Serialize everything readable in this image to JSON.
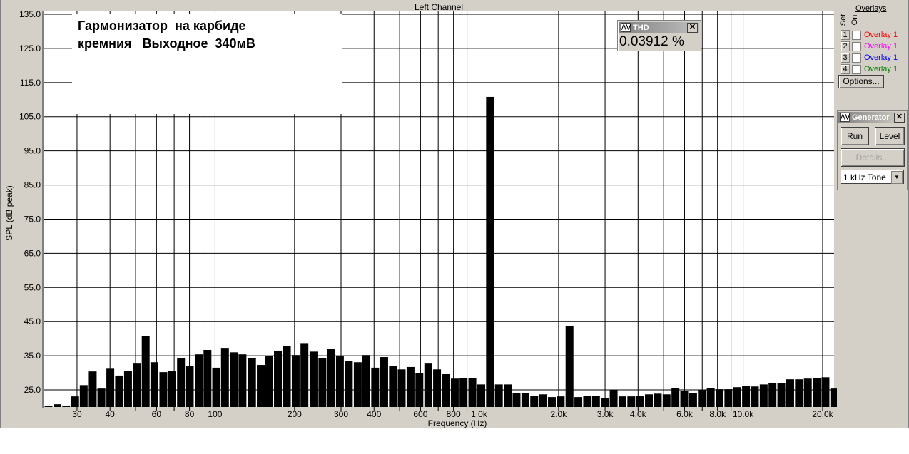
{
  "window": {
    "title": "Left Channel"
  },
  "annotation": {
    "line1": "Гармонизатор  на карбиде",
    "line2": "кремния   Выходное  340мВ"
  },
  "thd": {
    "title": "THD",
    "value": "0.03912 %",
    "icon": "waveform-icon"
  },
  "overlays": {
    "header": "Overlays",
    "set_label": "Set",
    "on_label": "On",
    "items": [
      {
        "set": "1",
        "label": "Overlay 1",
        "color": "#ff0000"
      },
      {
        "set": "2",
        "label": "Overlay 1",
        "color": "#ff00ff"
      },
      {
        "set": "3",
        "label": "Overlay 1",
        "color": "#0000ff"
      },
      {
        "set": "4",
        "label": "Overlay 1",
        "color": "#008000"
      }
    ],
    "options_label": "Options..."
  },
  "generator": {
    "title": "Generator",
    "run_label": "Run",
    "level_label": "Level",
    "details_label": "Details...",
    "tone_value": "1 kHz Tone"
  },
  "chart_data": {
    "type": "bar",
    "xlabel": "Frequency (Hz)",
    "ylabel": "SPL (dB peak)",
    "xscale": "log",
    "xlim": [
      22.4,
      22100
    ],
    "ylim": [
      20,
      135
    ],
    "grid": true,
    "xticks": [
      {
        "v": 30,
        "l": "30"
      },
      {
        "v": 40,
        "l": "40"
      },
      {
        "v": 60,
        "l": "60"
      },
      {
        "v": 80,
        "l": "80"
      },
      {
        "v": 100,
        "l": "100"
      },
      {
        "v": 200,
        "l": "200"
      },
      {
        "v": 300,
        "l": "300"
      },
      {
        "v": 400,
        "l": "400"
      },
      {
        "v": 600,
        "l": "600"
      },
      {
        "v": 800,
        "l": "800"
      },
      {
        "v": 1000,
        "l": "1.0k"
      },
      {
        "v": 2000,
        "l": "2.0k"
      },
      {
        "v": 3000,
        "l": "3.0k"
      },
      {
        "v": 4000,
        "l": "4.0k"
      },
      {
        "v": 6000,
        "l": "6.0k"
      },
      {
        "v": 8000,
        "l": "8.0k"
      },
      {
        "v": 10000,
        "l": "10.0k"
      },
      {
        "v": 20000,
        "l": "20.0k"
      }
    ],
    "xgrid": [
      30,
      40,
      50,
      60,
      70,
      80,
      90,
      100,
      200,
      300,
      400,
      500,
      600,
      700,
      800,
      900,
      1000,
      2000,
      3000,
      4000,
      5000,
      6000,
      7000,
      8000,
      9000,
      10000,
      20000
    ],
    "yticks": [
      "25.0",
      "35.0",
      "45.0",
      "55.0",
      "65.0",
      "75.0",
      "85.0",
      "95.0",
      "105.0",
      "115.0",
      "125.0",
      "135.0"
    ],
    "x": [
      23.4,
      25.3,
      27.3,
      29.5,
      31.8,
      34.4,
      37.1,
      40.1,
      43.3,
      46.8,
      50.5,
      54.6,
      58.9,
      63.7,
      68.8,
      74.3,
      80.2,
      86.7,
      93.6,
      101,
      109,
      118,
      127,
      138,
      149,
      160,
      173,
      187,
      202,
      218,
      236,
      255,
      275,
      297,
      321,
      347,
      374,
      404,
      437,
      472,
      509,
      550,
      594,
      642,
      693,
      749,
      809,
      873,
      943,
      1019,
      1100,
      1188,
      1283,
      1386,
      1497,
      1617,
      1746,
      1886,
      2037,
      2200,
      2376,
      2566,
      2771,
      2993,
      3233,
      3491,
      3771,
      4073,
      4398,
      4750,
      5130,
      5541,
      5984,
      6463,
      6980,
      7538,
      8141,
      8793,
      9496,
      10256,
      11076,
      11962,
      12919,
      13953,
      15069,
      16275,
      17577,
      18983,
      20502,
      22142
    ],
    "values": [
      20.3,
      20.8,
      20.3,
      23.1,
      26.4,
      30.4,
      25.4,
      31.2,
      29.2,
      30.6,
      32.7,
      40.8,
      33.1,
      30.2,
      30.6,
      34.4,
      32.1,
      35.4,
      36.7,
      31.5,
      37.3,
      36.0,
      35.4,
      34.2,
      32.3,
      35.0,
      36.5,
      37.9,
      35.2,
      38.7,
      36.2,
      34.2,
      36.9,
      35.0,
      33.5,
      33.1,
      35.2,
      31.5,
      34.6,
      32.1,
      31.0,
      31.7,
      30.0,
      32.7,
      31.0,
      29.6,
      28.3,
      28.5,
      28.5,
      26.6,
      110.8,
      26.6,
      26.6,
      24.1,
      24.1,
      23.3,
      23.7,
      22.9,
      23.1,
      43.6,
      22.9,
      23.3,
      23.3,
      22.5,
      25.0,
      23.1,
      23.1,
      23.3,
      23.7,
      23.9,
      23.7,
      25.6,
      24.6,
      24.1,
      25.0,
      25.6,
      25.2,
      25.2,
      25.8,
      26.2,
      26.0,
      26.6,
      27.1,
      26.9,
      28.1,
      28.1,
      28.3,
      28.5,
      28.7,
      25.4
    ]
  }
}
